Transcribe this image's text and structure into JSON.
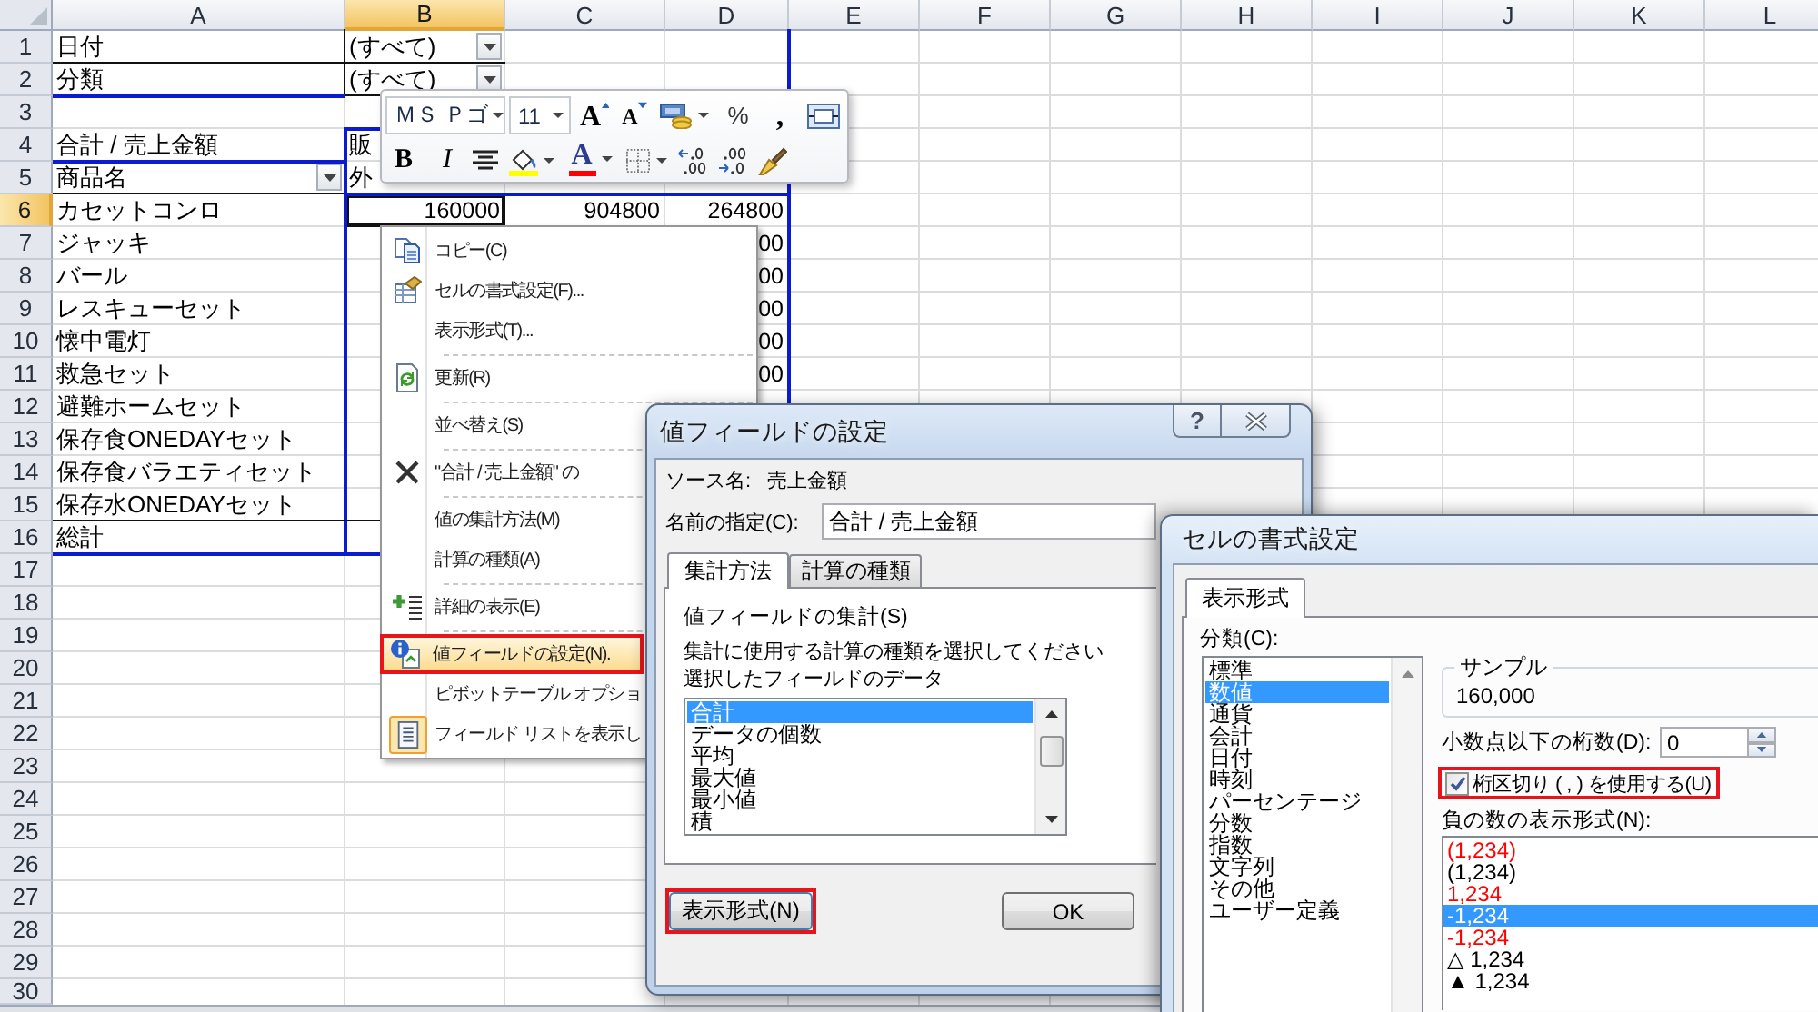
{
  "sheet": {
    "columns": [
      {
        "label": "A",
        "selected": false
      },
      {
        "label": "B",
        "selected": true
      },
      {
        "label": "C",
        "selected": false
      },
      {
        "label": "D",
        "selected": false
      },
      {
        "label": "E",
        "selected": false
      },
      {
        "label": "F",
        "selected": false
      },
      {
        "label": "G",
        "selected": false
      },
      {
        "label": "H",
        "selected": false
      },
      {
        "label": "I",
        "selected": false
      },
      {
        "label": "J",
        "selected": false
      },
      {
        "label": "K",
        "selected": false
      },
      {
        "label": "L",
        "selected": false
      }
    ],
    "rows": [
      {
        "label": "1",
        "selected": false
      },
      {
        "label": "2",
        "selected": false
      },
      {
        "label": "3",
        "selected": false
      },
      {
        "label": "4",
        "selected": false
      },
      {
        "label": "5",
        "selected": false
      },
      {
        "label": "6",
        "selected": true
      },
      {
        "label": "7",
        "selected": false
      },
      {
        "label": "8",
        "selected": false
      },
      {
        "label": "9",
        "selected": false
      },
      {
        "label": "10",
        "selected": false
      },
      {
        "label": "11",
        "selected": false
      },
      {
        "label": "12",
        "selected": false
      },
      {
        "label": "13",
        "selected": false
      },
      {
        "label": "14",
        "selected": false
      },
      {
        "label": "15",
        "selected": false
      },
      {
        "label": "16",
        "selected": false
      },
      {
        "label": "17",
        "selected": false
      },
      {
        "label": "18",
        "selected": false
      },
      {
        "label": "19",
        "selected": false
      },
      {
        "label": "20",
        "selected": false
      },
      {
        "label": "21",
        "selected": false
      },
      {
        "label": "22",
        "selected": false
      },
      {
        "label": "23",
        "selected": false
      },
      {
        "label": "24",
        "selected": false
      },
      {
        "label": "25",
        "selected": false
      },
      {
        "label": "26",
        "selected": false
      },
      {
        "label": "27",
        "selected": false
      },
      {
        "label": "28",
        "selected": false
      },
      {
        "label": "29",
        "selected": false
      },
      {
        "label": "30",
        "selected": false
      }
    ]
  },
  "pivot": {
    "filters": [
      {
        "label": "日付",
        "value": "(すべて)"
      },
      {
        "label": "分類",
        "value": "(すべて)"
      }
    ],
    "values_label": "合計 / 売上金額",
    "column_field": "販",
    "row_field": "商品名",
    "column_items": [
      "外"
    ],
    "rows": [
      {
        "label": "カセットコンロ",
        "values": [
          "160000",
          "904800",
          "264800"
        ]
      },
      {
        "label": "ジャッキ",
        "values": [
          "00"
        ]
      },
      {
        "label": "バール",
        "values": [
          "00"
        ]
      },
      {
        "label": "レスキューセット",
        "values": [
          "00"
        ]
      },
      {
        "label": "懐中電灯",
        "values": [
          "00"
        ]
      },
      {
        "label": "救急セット",
        "values": [
          "00"
        ]
      },
      {
        "label": "避難ホームセット"
      },
      {
        "label": "保存食ONEDAYセット"
      },
      {
        "label": "保存食バラエティセット"
      },
      {
        "label": "保存水ONEDAYセット"
      }
    ],
    "total_label": "総計"
  },
  "mini_toolbar": {
    "top_controls": [
      {
        "kind": "font",
        "value": "ＭＳ Ｐゴ"
      },
      {
        "kind": "size",
        "value": "11"
      },
      {
        "kind": "grow",
        "label": "A"
      },
      {
        "kind": "shrink",
        "label": "A"
      },
      {
        "kind": "currency"
      },
      {
        "kind": "percent",
        "label": "%"
      },
      {
        "kind": "comma",
        "label": ","
      },
      {
        "kind": "merge"
      }
    ],
    "bottom_controls": [
      {
        "kind": "bold",
        "label": "B"
      },
      {
        "kind": "italic",
        "label": "I"
      },
      {
        "kind": "center"
      },
      {
        "kind": "fill"
      },
      {
        "kind": "fontcolor",
        "label": "A"
      },
      {
        "kind": "borders"
      },
      {
        "kind": "incdecimal"
      },
      {
        "kind": "decdecimal"
      },
      {
        "kind": "painter"
      }
    ]
  },
  "context_menu": {
    "items": [
      {
        "kind": "copy",
        "label": "コピー(C)",
        "selected": false,
        "checked": false,
        "annotated": false
      },
      {
        "kind": "format",
        "label": "セルの書式設定(F)...",
        "selected": false,
        "checked": false,
        "annotated": false
      },
      {
        "kind": "plain",
        "label": "表示形式(T)...",
        "selected": false,
        "checked": false,
        "annotated": false
      },
      {
        "kind": "separator"
      },
      {
        "kind": "refresh",
        "label": "更新(R)",
        "selected": false,
        "checked": false,
        "annotated": false
      },
      {
        "kind": "separator"
      },
      {
        "kind": "plain",
        "label": "並べ替え(S)",
        "selected": false,
        "checked": false,
        "annotated": false
      },
      {
        "kind": "separator"
      },
      {
        "kind": "remove",
        "label": "\"合計 / 売上金額\" の",
        "selected": false,
        "checked": false,
        "annotated": false
      },
      {
        "kind": "separator"
      },
      {
        "kind": "plain",
        "label": "値の集計方法(M)",
        "selected": false,
        "checked": false,
        "annotated": false
      },
      {
        "kind": "plain",
        "label": "計算の種類(A)",
        "selected": false,
        "checked": false,
        "annotated": false
      },
      {
        "kind": "separator"
      },
      {
        "kind": "expand",
        "label": "詳細の表示(E)",
        "selected": false,
        "checked": false,
        "annotated": false
      },
      {
        "kind": "separator"
      },
      {
        "kind": "fieldsettings",
        "label": "値フィールドの設定(N).",
        "selected": true,
        "checked": false,
        "annotated": true
      },
      {
        "kind": "plain",
        "label": "ピボットテーブル オプショ",
        "selected": false,
        "checked": false,
        "annotated": false
      },
      {
        "kind": "fieldlist",
        "label": "フィールド リストを表示し",
        "selected": false,
        "checked": true,
        "annotated": false
      }
    ]
  },
  "value_field_dialog": {
    "title": "値フィールドの設定",
    "help": "?",
    "source_label": "ソース名:",
    "source_value": "売上金額",
    "name_label": "名前の指定(C):",
    "name_value": "合計 / 売上金額",
    "tabs": [
      {
        "label": "集計方法",
        "selected": true
      },
      {
        "label": "計算の種類",
        "selected": false
      }
    ],
    "group_label": "値フィールドの集計(S)",
    "instructions": "集計に使用する計算の種類を選択してください選択したフィールドのデータ",
    "functions": [
      {
        "label": "合計",
        "selected": true
      },
      {
        "label": "データの個数",
        "selected": false
      },
      {
        "label": "平均",
        "selected": false
      },
      {
        "label": "最大値",
        "selected": false
      },
      {
        "label": "最小値",
        "selected": false
      },
      {
        "label": "積",
        "selected": false
      }
    ],
    "buttons": [
      {
        "label": "表示形式(N)",
        "annotated": true
      },
      {
        "label": "OK",
        "annotated": false
      }
    ]
  },
  "format_cells_dialog": {
    "title": "セルの書式設定",
    "tabs": [
      {
        "label": "表示形式",
        "selected": true
      }
    ],
    "category_label": "分類(C):",
    "categories": [
      {
        "label": "標準",
        "selected": false
      },
      {
        "label": "数値",
        "selected": true
      },
      {
        "label": "通貨",
        "selected": false
      },
      {
        "label": "会計",
        "selected": false
      },
      {
        "label": "日付",
        "selected": false
      },
      {
        "label": "時刻",
        "selected": false
      },
      {
        "label": "パーセンテージ",
        "selected": false
      },
      {
        "label": "分数",
        "selected": false
      },
      {
        "label": "指数",
        "selected": false
      },
      {
        "label": "文字列",
        "selected": false
      },
      {
        "label": "その他",
        "selected": false
      },
      {
        "label": "ユーザー定義",
        "selected": false
      }
    ],
    "sample_label": "サンプル",
    "sample_value": "160,000",
    "decimal_label": "小数点以下の桁数(D):",
    "decimal_value": "0",
    "separator_checkbox": {
      "label": "桁区切り ( , ) を使用する(U)",
      "checked": true,
      "annotated": true
    },
    "negative_label": "負の数の表示形式(N):",
    "negative_formats": [
      {
        "label": "(1,234)",
        "color": "#ff0000",
        "selected": false
      },
      {
        "label": "(1,234)",
        "color": "#000000",
        "selected": false
      },
      {
        "label": "1,234",
        "color": "#ff0000",
        "selected": false
      },
      {
        "label": "-1,234",
        "selected": true
      },
      {
        "label": "-1,234",
        "color": "#ff0000",
        "selected": false
      },
      {
        "label": "△ 1,234",
        "color": "#000000",
        "selected": false
      },
      {
        "label": "▲ 1,234",
        "color": "#000000",
        "selected": false
      }
    ]
  }
}
